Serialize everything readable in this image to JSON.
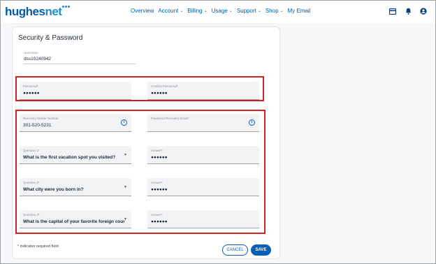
{
  "brand": {
    "name_part1": "hughes",
    "name_part2": "net"
  },
  "nav": {
    "items": [
      {
        "label": "Overview",
        "has_dropdown": false
      },
      {
        "label": "Account",
        "has_dropdown": true
      },
      {
        "label": "Billing",
        "has_dropdown": true
      },
      {
        "label": "Usage",
        "has_dropdown": true
      },
      {
        "label": "Support",
        "has_dropdown": true
      },
      {
        "label": "Shop",
        "has_dropdown": true
      },
      {
        "label": "My Email",
        "has_dropdown": false
      }
    ],
    "dropdown_glyph": "⌄",
    "icons": [
      "billing-card-icon",
      "notifications-bell-icon",
      "account-user-icon"
    ]
  },
  "page": {
    "title": "Security & Password"
  },
  "username": {
    "label": "Username",
    "value": "dss10240942"
  },
  "password": {
    "password_label": "Password*",
    "password_value": "●●●●●●",
    "confirm_label": "Confirm Password*",
    "confirm_value": "●●●●●●"
  },
  "recovery": {
    "mobile_label": "Recovery Mobile Number",
    "mobile_value": "301-520-5231",
    "email_label": "Password Recovery Email*",
    "email_value": "",
    "info_glyph": "i"
  },
  "questions": [
    {
      "question_label": "Question 1*",
      "question_value": "What is the first vacation spot you visited?",
      "answer_label": "Answer*",
      "answer_value": "●●●●●●"
    },
    {
      "question_label": "Question 2*",
      "question_value": "What city were you born in?",
      "answer_label": "Answer*",
      "answer_value": "●●●●●●"
    },
    {
      "question_label": "Question 3*",
      "question_value": "What is the capital of your favorite foreign coun...",
      "answer_label": "Answer*",
      "answer_value": "●●●●●●"
    }
  ],
  "footer": {
    "required_note": "* indicates required field",
    "cancel_label": "CANCEL",
    "save_label": "SAVE"
  },
  "colors": {
    "brand_blue": "#005ca8",
    "accent_blue": "#0a5fb4",
    "highlight_red": "#d42020"
  }
}
